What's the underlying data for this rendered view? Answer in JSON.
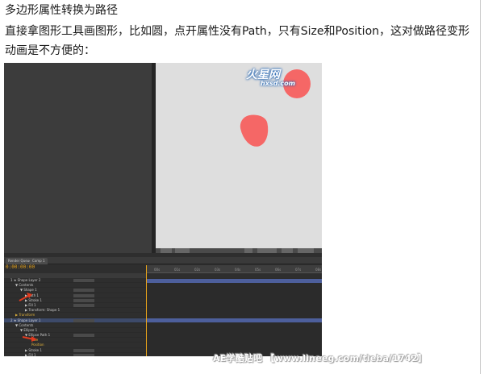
{
  "heading": "多边形属性转换为路径",
  "paragraph": "直接拿图形工具画图形，比如圆，点开属性没有Path，只有Size和Position，这对做路径变形动画是不方便的：",
  "screenshot": {
    "logo_text": "火星网",
    "logo_sub": "hxsd.com",
    "timeline_tab_labels": [
      "Render Queue",
      "Comp 1"
    ],
    "timecode": "0:00:00:00",
    "ruler_ticks": [
      "00s",
      "01s",
      "02s",
      "03s",
      "04s",
      "05s",
      "06s",
      "07s",
      "08s"
    ],
    "layer_rows": [
      {
        "label": "1    ★ Shape Layer 2",
        "indent": 8,
        "highlight": false,
        "yellow": false
      },
      {
        "label": "▼ Contents",
        "indent": 14,
        "highlight": false,
        "yellow": false
      },
      {
        "label": "▼ Shape 1",
        "indent": 20,
        "highlight": false,
        "yellow": false
      },
      {
        "label": "▶ Path 1",
        "indent": 26,
        "highlight": false,
        "yellow": false
      },
      {
        "label": "▶ Stroke 1",
        "indent": 26,
        "highlight": false,
        "yellow": false
      },
      {
        "label": "▶ Fill 1",
        "indent": 26,
        "highlight": false,
        "yellow": false
      },
      {
        "label": "▶ Transform: Shape 1",
        "indent": 26,
        "highlight": false,
        "yellow": false
      },
      {
        "label": "▶ Transform",
        "indent": 14,
        "highlight": false,
        "yellow": true
      },
      {
        "label": "2    ★ Shape Layer 1",
        "indent": 8,
        "highlight": true,
        "yellow": false
      },
      {
        "label": "▼ Contents",
        "indent": 14,
        "highlight": false,
        "yellow": false
      },
      {
        "label": "▼ Ellipse 1",
        "indent": 20,
        "highlight": false,
        "yellow": false
      },
      {
        "label": "▼ Ellipse Path 1",
        "indent": 26,
        "highlight": false,
        "yellow": false
      },
      {
        "label": "Size",
        "indent": 34,
        "highlight": false,
        "yellow": true
      },
      {
        "label": "Position",
        "indent": 34,
        "highlight": false,
        "yellow": true
      },
      {
        "label": "▶ Stroke 1",
        "indent": 26,
        "highlight": false,
        "yellow": false
      },
      {
        "label": "▶ Fill 1",
        "indent": 26,
        "highlight": false,
        "yellow": false
      },
      {
        "label": "▶ Transform: Ellipse 1",
        "indent": 26,
        "highlight": false,
        "yellow": false
      }
    ]
  },
  "watermark": "AE学酷贴吧 【www.lineeg.com/tieba/1742】",
  "colors": {
    "shape_fill": "#f56766",
    "timecode": "#e8a41a",
    "arrow": "#e23b1f"
  }
}
